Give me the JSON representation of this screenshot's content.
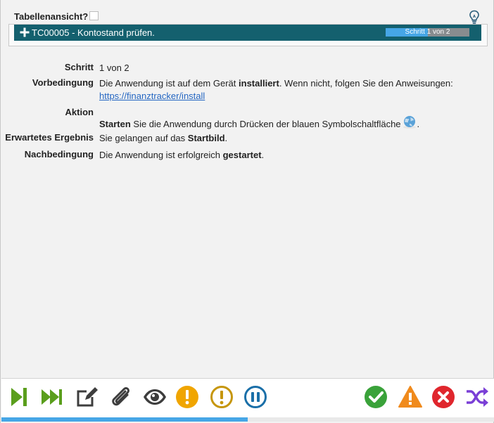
{
  "header": {
    "table_view_label": "Tabellenansicht?",
    "table_view_checked": false
  },
  "test_case": {
    "title": "TC00005 - Kontostand prüfen.",
    "progress_label": "Schritt 1 von 2",
    "progress_fraction": 0.5,
    "bar_color": "#14606e",
    "progress_color": "#46a6e6"
  },
  "step": {
    "schritt_label": "Schritt",
    "schritt_value": "1 von 2",
    "vorbedingung_label": "Vorbedingung",
    "vorbedingung_text_1": "Die Anwendung ist auf dem Gerät ",
    "vorbedingung_bold": "installiert",
    "vorbedingung_text_2": ". Wenn nicht, folgen Sie den Anweisungen: ",
    "vorbedingung_link": "https://finanztracker/install",
    "aktion_label": "Aktion",
    "aktion_bold": "Starten",
    "aktion_text": " Sie die Anwendung durch Drücken der blauen Symbolschaltfläche",
    "aktion_icon": "globe-icon",
    "aktion_end": ".",
    "erwartet_label": "Erwartetes Ergebnis",
    "erwartet_text": "Sie gelangen auf das ",
    "erwartet_bold": "Startbild",
    "erwartet_end": ".",
    "nach_label": "Nachbedingung",
    "nach_text": "Die Anwendung ist erfolgreich ",
    "nach_bold": "gestartet",
    "nach_end": "."
  },
  "toolbar": {
    "icons": [
      "step-forward-icon",
      "fast-forward-icon",
      "edit-icon",
      "paperclip-icon",
      "eye-icon",
      "warning-circle-icon",
      "warning-circle-outline-icon",
      "pause-icon",
      "check-icon",
      "warning-triangle-icon",
      "fail-icon",
      "shuffle-icon"
    ],
    "colors": {
      "green": "#4e9a06",
      "dark": "#3d3d3d",
      "yellow": "#f0a500",
      "mustard": "#c6960c",
      "blue": "#1a6fa8",
      "ok": "#3aa23a",
      "orange": "#f08a1c",
      "red": "#e0262d",
      "purple": "#7a3fd6"
    }
  },
  "bottom_progress_fraction": 0.5
}
